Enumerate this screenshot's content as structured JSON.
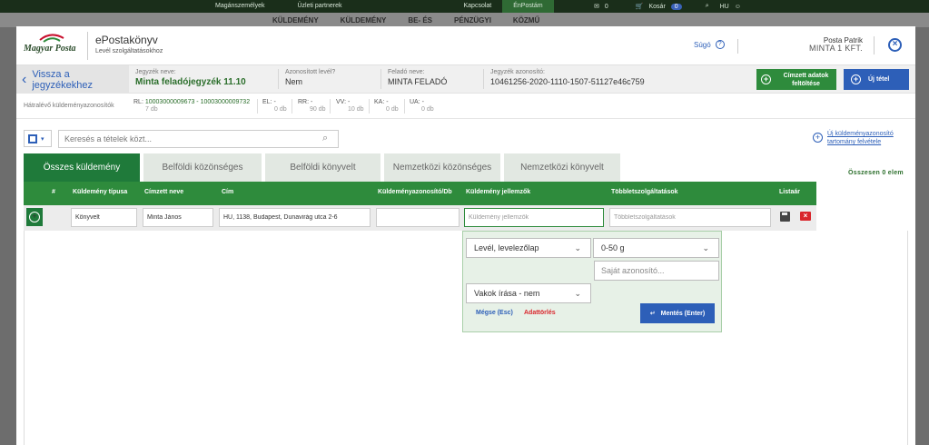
{
  "background": {
    "topnav": [
      "Magánszemélyek",
      "Üzleti partnerek",
      "Kapcsolat",
      "ÉnPostám"
    ],
    "cart_count_left": "0",
    "cart_label": "Kosár",
    "cart_count": "0",
    "lang": "HU",
    "mainnav": [
      "KÜLDEMÉNY",
      "KÜLDEMÉNY",
      "BE- ÉS",
      "PÉNZÜGYI",
      "KÖZMŰ"
    ]
  },
  "header": {
    "logo_text": "Magyar Posta",
    "title": "ePostakönyv",
    "subtitle": "Levél szolgáltatásokhoz",
    "help_label": "Súgó",
    "user_name": "Posta Patrik",
    "user_company": "MINTA 1 KFT."
  },
  "infobar": {
    "back_label": "Vissza a jegyzékekhez",
    "fields": [
      {
        "label": "Jegyzék neve:",
        "value": "Minta feladójegyzék 11.10"
      },
      {
        "label": "Azonosított levél?",
        "value": "Nem"
      },
      {
        "label": "Feladó neve:",
        "value": "MINTA FELADÓ"
      },
      {
        "label": "Jegyzék azonosító:",
        "value": "10461256-2020-1110-1507-51127e46c759"
      }
    ],
    "btn_recipient": "Címzett adatok feltöltése",
    "btn_new_item": "Új tétel"
  },
  "counts": {
    "label": "Hátralévő küldeményazonosítók",
    "rl_key": "RL:",
    "rl_value": "10003000009673 - 10003000009732",
    "rl_db": "7 db",
    "items": [
      {
        "key": "EL:",
        "value": "-",
        "db": "0 db"
      },
      {
        "key": "RR:",
        "value": "-",
        "db": "90 db"
      },
      {
        "key": "VV:",
        "value": "-",
        "db": "10 db"
      },
      {
        "key": "KA:",
        "value": "-",
        "db": "0 db"
      },
      {
        "key": "UA:",
        "value": "-",
        "db": "0 db"
      }
    ]
  },
  "search": {
    "placeholder": "Keresés a tételek közt..."
  },
  "range_link": "Új küldeményazonosító tartomány felvétele",
  "total": "Összesen 0 elem",
  "tabs": [
    "Összes küldemény",
    "Belföldi közönséges",
    "Belföldi könyvelt",
    "Nemzetközi közönséges",
    "Nemzetközi könyvelt"
  ],
  "table": {
    "columns": [
      "#",
      "Küldemény típusa",
      "Címzett neve",
      "Cím",
      "Küldeményazonosító/Db",
      "Küldemény jellemzők",
      "Többletszolgáltatások",
      "Listaár"
    ],
    "row": {
      "type": "Könyvelt",
      "recipient": "Minta János",
      "address": "HU, 1138, Budapest, Dunavirág utca 2-6",
      "id": "",
      "features_placeholder": "Küldemény jellemzők",
      "extras_placeholder": "Többletszolgáltatások"
    }
  },
  "popup": {
    "type_select": "Levél, levelezőlap",
    "weight_select": "0-50 g",
    "own_id_placeholder": "Saját azonosító...",
    "braille_select": "Vakok írása - nem",
    "cancel": "Mégse (Esc)",
    "clear": "Adattörlés",
    "save": "Mentés (Enter)"
  }
}
